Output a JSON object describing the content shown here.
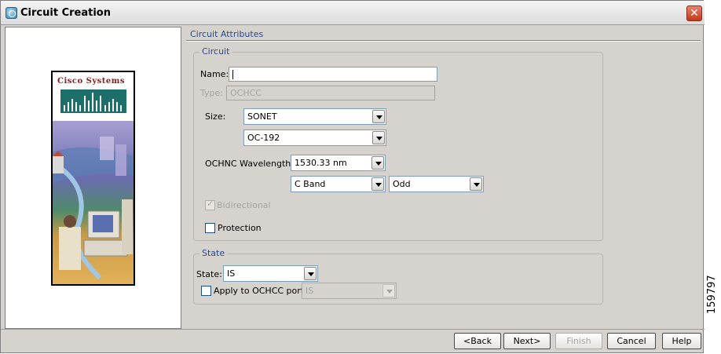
{
  "window": {
    "title": "Circuit Creation",
    "close_label": "✕"
  },
  "brand": {
    "name": "Cisco Systems"
  },
  "content": {
    "section_header": "Circuit Attributes",
    "circuit_group": {
      "title": "Circuit",
      "name_label": "Name:",
      "name_value": "",
      "type_label": "Type:",
      "type_value": "OCHCC",
      "size_label": "Size:",
      "size_value": "SONET",
      "rate_value": "OC-192",
      "wavelength_label": "OCHNC Wavelength:",
      "wavelength_value": "1530.33 nm",
      "band_value": "C Band",
      "parity_value": "Odd",
      "bidirectional_label": "Bidirectional",
      "bidirectional_checked": true,
      "protection_label": "Protection",
      "protection_checked": false
    },
    "state_group": {
      "title": "State",
      "state_label": "State:",
      "state_value": "IS",
      "apply_label": "Apply to OCHCC ports",
      "apply_value": "IS",
      "apply_checked": false
    }
  },
  "buttons": {
    "back": "<Back",
    "next": "Next>",
    "finish": "Finish",
    "cancel": "Cancel",
    "help": "Help"
  },
  "figure_id": "159797"
}
